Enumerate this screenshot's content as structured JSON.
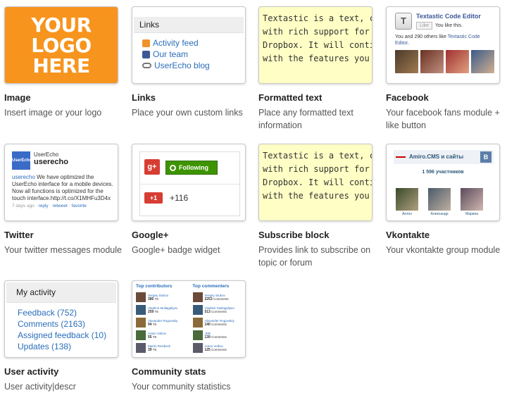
{
  "tiles": [
    {
      "title": "Image",
      "desc": "Insert image or your logo"
    },
    {
      "title": "Links",
      "desc": "Place your own custom links"
    },
    {
      "title": "Formatted text",
      "desc": "Place any formatted text information"
    },
    {
      "title": "Facebook",
      "desc": "Your facebook fans module + like button"
    },
    {
      "title": "Twitter",
      "desc": "Your twitter messages module"
    },
    {
      "title": "Google+",
      "desc": "Google+ badge widget"
    },
    {
      "title": "Subscribe block",
      "desc": "Provides link to subscribe on topic or forum"
    },
    {
      "title": "Vkontakte",
      "desc": "Your vkontakte group module"
    },
    {
      "title": "User activity",
      "desc": "User activity|descr"
    },
    {
      "title": "Community stats",
      "desc": "Your community statistics"
    }
  ],
  "logo": {
    "line1": "YOUR",
    "line2": "LOGO",
    "line3": "HERE",
    "color": "#f7941d"
  },
  "links_widget": {
    "header": "Links",
    "items": [
      "Activity feed",
      "Our team",
      "UserEcho blog"
    ]
  },
  "formatted_text": {
    "lines": [
      "Textastic is a text, code and",
      "with rich support for syntax",
      "Dropbox. It will continue to",
      "with the features you need"
    ],
    "bg": "#ffffc5"
  },
  "facebook": {
    "logo_letter": "T",
    "page_name": "Textastic Code Editor",
    "like_button": "Like",
    "you_like": "You like this.",
    "others_prefix": "You and 290 others like ",
    "others_link": "Textastic Code Editor",
    "others_suffix": "."
  },
  "twitter": {
    "logo_text": "UserEcho",
    "name_small": "UserEcho",
    "handle": "userecho",
    "tweet_user": "userecho",
    "tweet_text": " We have optimized the UserEcho interface for a mobile devices. Now all functions is optimized for the touch interface.http://t.co/X1MHFu3D4x",
    "time": "7 days ago",
    "reply": "reply",
    "retweet": "retweet",
    "favorite": "favorite"
  },
  "googleplus": {
    "logo": "g+",
    "follow_label": "Following",
    "plus_one": "+1",
    "count": "+116"
  },
  "subscribe": {
    "lines": [
      "Textastic is a text, code and",
      "with rich support for syntax",
      "Dropbox. It will continue to",
      "with the features you need"
    ]
  },
  "vkontakte": {
    "title": "Amiro.CMS и сайты",
    "badge": "В",
    "members": "1 596 участников",
    "people": [
      "Антон",
      "Александр",
      "Марина"
    ]
  },
  "my_activity": {
    "header": "My activity",
    "items": [
      "Feedback (752)",
      "Comments (2163)",
      "Assigned feedback (10)",
      "Updates (138)"
    ]
  },
  "community_stats": {
    "contributors_title": "Top contributors",
    "commenters_title": "Top commenters",
    "contributors": [
      {
        "name": "Sergey Stukov",
        "value": "385",
        "unit": "TE"
      },
      {
        "name": "Vladimir Mullagaliyev",
        "value": "259",
        "unit": "TE"
      },
      {
        "name": "Alexander Rogovskiy",
        "value": "94",
        "unit": "TE"
      },
      {
        "name": "Anton Volkov",
        "value": "55",
        "unit": "TE"
      },
      {
        "name": "Martin Reisbeck",
        "value": "39",
        "unit": "TE"
      }
    ],
    "commenters": [
      {
        "name": "Sergey Stukov",
        "value": "2253",
        "unit": "Comments"
      },
      {
        "name": "Vladimir Mullagaliyev",
        "value": "513",
        "unit": "Comments"
      },
      {
        "name": "Alexander Rogovskiy",
        "value": "140",
        "unit": "Comments"
      },
      {
        "name": "JDB",
        "value": "139",
        "unit": "Comments"
      },
      {
        "name": "Anton Volkov",
        "value": "125",
        "unit": "Comments"
      }
    ]
  }
}
